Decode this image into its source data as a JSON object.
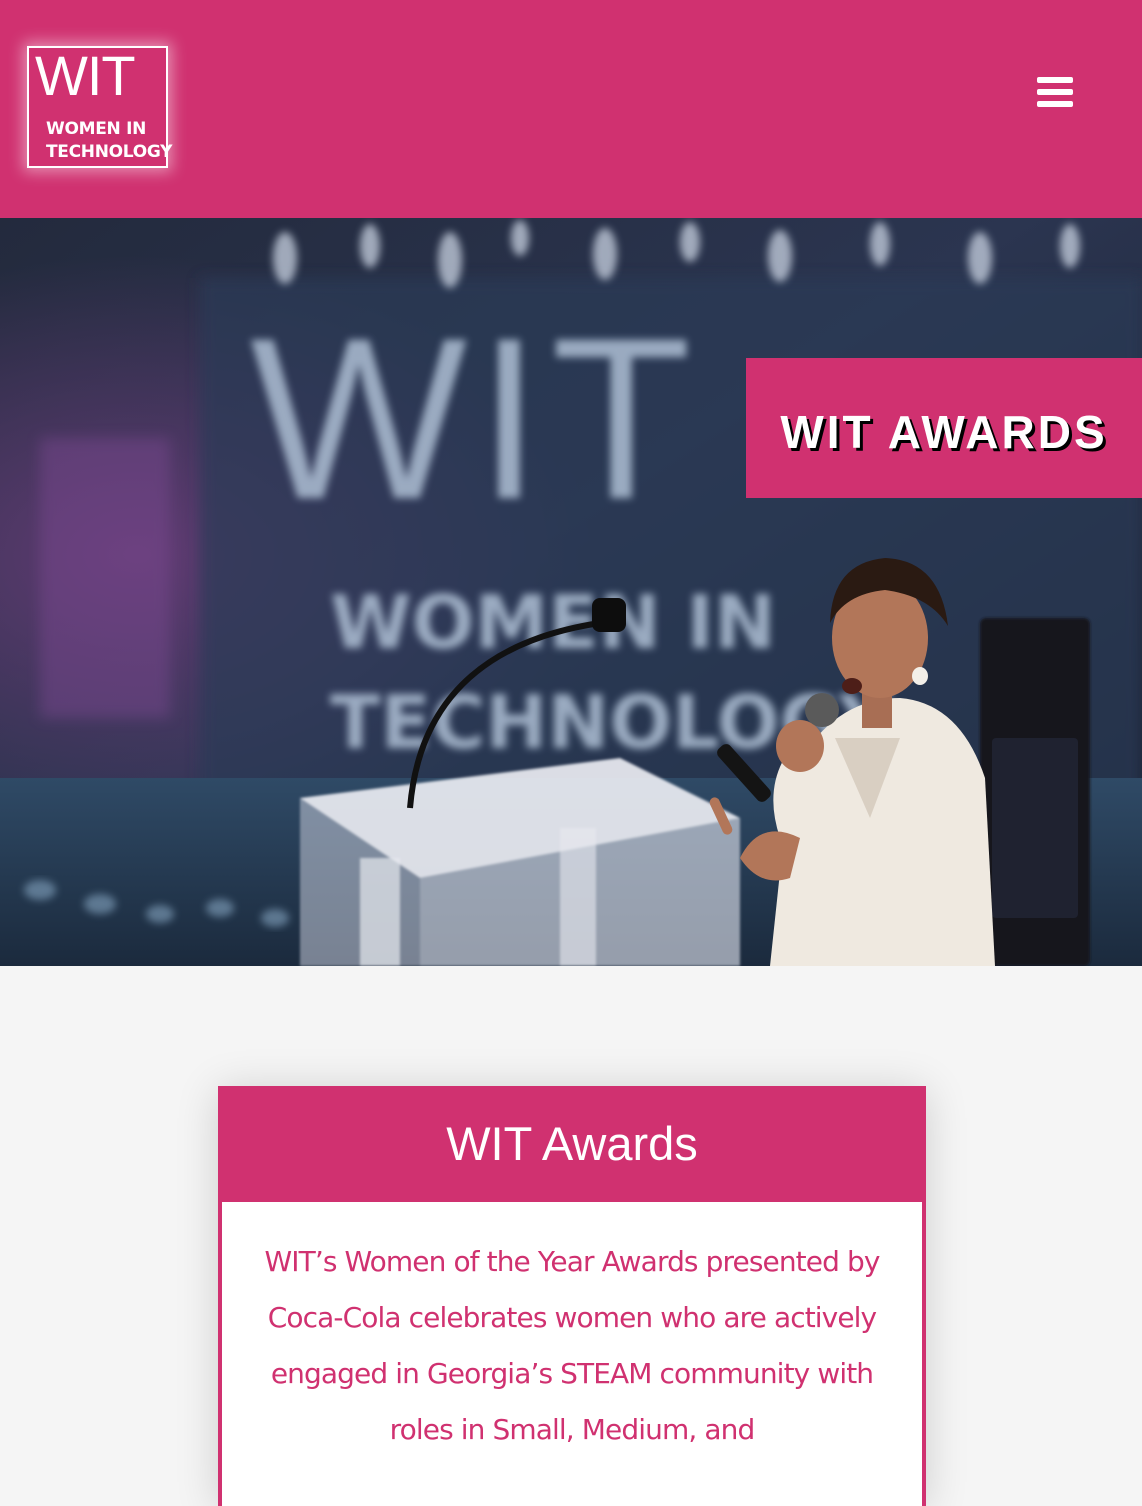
{
  "header": {
    "logo": {
      "mark": "WIT",
      "line1": "WOMEN IN",
      "line2": "TECHNOLOGY"
    },
    "menu_icon": "hamburger-menu-icon"
  },
  "hero": {
    "badge_title": "WIT AWARDS",
    "backdrop_logo": {
      "mark": "WIT",
      "line1": "WOMEN IN",
      "line2": "TECHNOLOGY"
    }
  },
  "card": {
    "title": "WIT Awards",
    "body": "WIT’s Women of the Year Awards presented by Coca-Cola celebrates women who are actively engaged in Georgia’s STEAM community with roles in Small, Medium, and"
  },
  "colors": {
    "brand_pink": "#d03170",
    "white": "#ffffff",
    "page_background": "#f5f5f5",
    "hero_dark": "#1d2637"
  }
}
